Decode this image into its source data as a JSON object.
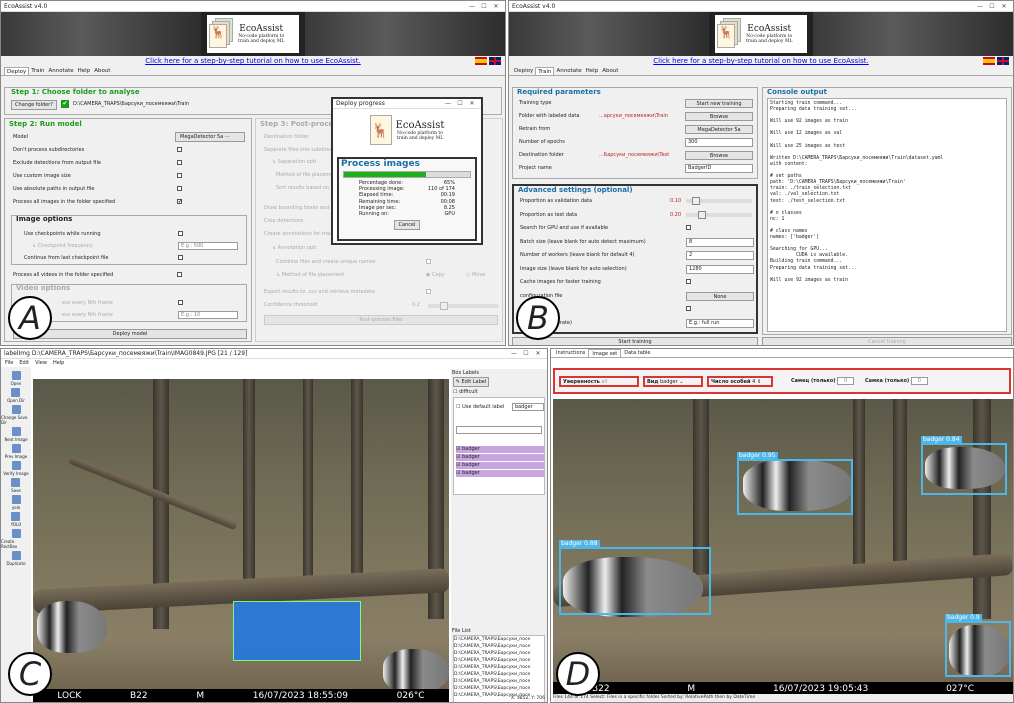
{
  "panelA": {
    "window_title": "EcoAssist v4.0",
    "logo_name": "EcoAssist",
    "logo_sub1": "No-code platform to",
    "logo_sub2": "train and deploy ML",
    "tutorial_link": "Click here for a step-by-step tutorial on how to use EcoAssist.",
    "tabs": [
      "Deploy",
      "Train",
      "Annotate",
      "Help",
      "About"
    ],
    "step1": "Step 1: Choose folder to analyse",
    "change_folder": "Change folder?",
    "folder_path": "D:\\CAMERA_TRAPS\\Барсуки_посемеяжи\\Train",
    "step2": "Step 2: Run model",
    "model_label": "Model",
    "model_value": "MegaDetector 5a",
    "options": [
      "Don't process subdirectories",
      "Exclude detections from output file",
      "Use custom image size",
      "Use absolute paths in output file",
      "Process all images in the folder specified"
    ],
    "image_options": "Image options",
    "use_checkpoints": "Use checkpoints while running",
    "checkpoint_freq": "↳ Checkpoint frequency",
    "checkpoint_placeholder": "E.g.: 500",
    "continue_checkpoint": "Continue from last checkpoint file",
    "process_videos": "Process all videos in the folder specified",
    "video_opt": "Video options",
    "every_frame": "ess every Nth frame",
    "nth_frame": "ess every Nth frame",
    "nth_placeholder": "E.g.: 10",
    "deploy_button": "Deploy model",
    "step3": "Step 3: Post-process",
    "dest_folder": "Destination folder",
    "separate": "Separate files into subdirect",
    "sep_opts": "↳ Separation opti",
    "method_place": "Method of file placeme",
    "sort_results": "Sort results based on",
    "draw_boxes": "Draw bounding boxes and",
    "crop": "Crop detections",
    "create_ann": "Create annotations for train",
    "annotation_opts": "↳ Annotation opti",
    "combine": "Combine files and create unique names",
    "method_file": "↳ Method of file placement",
    "copy": "Copy",
    "move": "Move",
    "export": "Export results to .csv and retrieve metadata",
    "confidence": "Confidence threshold",
    "confidence_val": "0.2",
    "postprocess_btn": "Post-process files",
    "dialog_title": "Deploy progress",
    "dialog_heading": "Process images",
    "dialog_rows": [
      {
        "k": "Percentage done:",
        "v": "65%"
      },
      {
        "k": "Processing image:",
        "v": "110 of 174"
      },
      {
        "k": "Elapsed time:",
        "v": "00:19"
      },
      {
        "k": "Remaining time:",
        "v": "00:08"
      },
      {
        "k": "Image per sec:",
        "v": "8.25"
      },
      {
        "k": "Running on:",
        "v": "GPU"
      }
    ],
    "progress": 0.65,
    "cancel": "Cancel"
  },
  "panelB": {
    "window_title": "EcoAssist v4.0",
    "tabs": [
      "Deploy",
      "Train",
      "Annotate",
      "Help",
      "About"
    ],
    "required": "Required parameters",
    "req_rows": [
      {
        "k": "Training type",
        "v": "Start new training",
        "kind": "btn"
      },
      {
        "k": "Folder with labeled data",
        "v": "Browse",
        "path": "...арсуки_посемеяжи\\Train",
        "kind": "btn"
      },
      {
        "k": "Retrain from",
        "v": "MegaDetector 5a",
        "kind": "btn"
      },
      {
        "k": "Number of epochs",
        "v": "300",
        "kind": "inp"
      },
      {
        "k": "Destination folder",
        "v": "Browse",
        "path": "...Барсуки_посемеяжи\\Test",
        "kind": "btn"
      },
      {
        "k": "Project name",
        "v": "BadgerID",
        "kind": "inp"
      }
    ],
    "advanced": "Advanced settings (optional)",
    "adv_rows": [
      {
        "k": "Proportion as validation data",
        "v": "0.10",
        "kind": "slider"
      },
      {
        "k": "Proportion as test data",
        "v": "0.20",
        "kind": "slider"
      },
      {
        "k": "Search for GPU and use if available",
        "v": "",
        "kind": "cb"
      },
      {
        "k": "Batch size (leave blank for auto detect maximum)",
        "v": "8",
        "kind": "inp"
      },
      {
        "k": "Number of workers (leave blank for default 4)",
        "v": "2",
        "kind": "inp"
      },
      {
        "k": "Image size (leave blank for auto selection)",
        "v": "1280",
        "kind": "inp"
      },
      {
        "k": "Cache images for faster training",
        "v": "",
        "kind": "cb"
      },
      {
        "k": "configuration file",
        "v": "None",
        "kind": "btn"
      },
      {
        "k": "ters",
        "v": "",
        "kind": "cb"
      },
      {
        "k": "lank for auto iterate)",
        "v": "E.g.: full run",
        "kind": "inp"
      }
    ],
    "start_training": "Start training",
    "console_title": "Console output",
    "console_text": "Starting train command...\nPreparing data training set...\n\nWill use 92 images as train\n\nWill use 12 images as val\n\nWill use 25 images as test\n\nWritten D:\\CAMERA_TRAPS\\Барсуки_посемеяжи\\Train\\dataset.yaml\nwith content:\n\n# set paths\npath: 'D:\\CAMERA_TRAPS\\Барсуки_посемеяжи\\Train'\ntrain: ./train_selection.txt\nval: ./val_selection.txt\ntest: ./test_selection.txt\n\n# n classes\nnc: 1\n\n# class names\nnames: ['badger']\n\nSearching for GPU...\n         CUDA is available.\nBuilding train command...\nPreparing data training set...\n\nWill use 92 images as train",
    "cancel_training": "Cancel training"
  },
  "panelC": {
    "window_title": "labelImg D:\\CAMERA_TRAPS\\Барсуки_посемеяжи\\Train\\IMAG0849.JPG [21 / 129]",
    "menu": [
      "File",
      "Edit",
      "View",
      "Help"
    ],
    "tools": [
      "Open",
      "Open Dir",
      "Change Save Dir",
      "Next Image",
      "Prev Image",
      "Verify Image",
      "Save",
      "yolo",
      "YOLO",
      "Create RectBox",
      "Duplicate"
    ],
    "box_labels": "Box Labels",
    "edit_label": "Edit Label",
    "difficult": "difficult",
    "use_default": "Use default label",
    "default_label": "badger",
    "labels": [
      "badger",
      "badger",
      "badger",
      "badger"
    ],
    "file_list": "File List",
    "files": [
      "D:\\CAMERA_TRAPS\\Барсуки_посе",
      "D:\\CAMERA_TRAPS\\Барсуки_посе",
      "D:\\CAMERA_TRAPS\\Барсуки_посе",
      "D:\\CAMERA_TRAPS\\Барсуки_посе",
      "D:\\CAMERA_TRAPS\\Барсуки_посе",
      "D:\\CAMERA_TRAPS\\Барсуки_посе",
      "D:\\CAMERA_TRAPS\\Барсуки_посе",
      "D:\\CAMERA_TRAPS\\Барсуки_посе",
      "D:\\CAMERA_TRAPS\\Барсуки_посе"
    ],
    "hud": [
      "LOCK",
      "B22",
      "M",
      "16/07/2023 18:55:09",
      "026°C"
    ],
    "coords": "X: 3852; Y: 706"
  },
  "panelD": {
    "tabs": [
      "Instructions",
      "Image set",
      "Data table"
    ],
    "fields": [
      {
        "k": "Уверенность",
        "v": "all"
      },
      {
        "k": "Вид",
        "v": "badger"
      },
      {
        "k": "Число особей",
        "v": "4"
      },
      {
        "k": "Самец (только)",
        "v": "0"
      },
      {
        "k": "Самка (только)",
        "v": "0"
      }
    ],
    "detections": [
      {
        "label": "badger 0.95"
      },
      {
        "label": "badger 0.84"
      },
      {
        "label": "badger 0.88"
      },
      {
        "label": "badger 0.9"
      }
    ],
    "hud": [
      "B22",
      "M",
      "16/07/2023 19:05:43",
      "027°C"
    ],
    "status": "Files  144  of  174    Select:  Files in a specific folder    Sorted by:  RelativePath  then by  DateTime"
  },
  "letters": [
    "A",
    "B",
    "C",
    "D"
  ]
}
